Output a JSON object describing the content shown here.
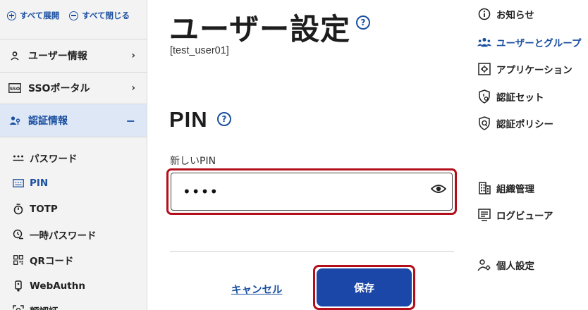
{
  "sidebar": {
    "expand_all": "すべて展開",
    "collapse_all": "すべて閉じる",
    "items": [
      {
        "label": "ユーザー情報",
        "icon": "person-icon",
        "chevron": "›"
      },
      {
        "label": "SSOポータル",
        "icon": "sso-icon",
        "chevron": "›"
      },
      {
        "label": "認証情報",
        "icon": "person-key-icon",
        "chevron": "−"
      }
    ],
    "sub_items": [
      {
        "label": "パスワード",
        "icon": "password-dots-icon"
      },
      {
        "label": "PIN",
        "icon": "pin-pad-icon"
      },
      {
        "label": "TOTP",
        "icon": "timer-icon"
      },
      {
        "label": "一時パスワード",
        "icon": "clock-key-icon"
      },
      {
        "label": "QRコード",
        "icon": "qr-code-icon"
      },
      {
        "label": "WebAuthn",
        "icon": "security-key-icon"
      },
      {
        "label": "顔認証",
        "icon": "face-scan-icon"
      }
    ]
  },
  "main": {
    "title": "ユーザー設定",
    "user_id": "[test_user01]",
    "section_title": "PIN",
    "pin_label": "新しいPIN",
    "pin_value": "••••",
    "cancel_label": "キャンセル",
    "save_label": "保存"
  },
  "right_nav": {
    "items": [
      {
        "label": "お知らせ",
        "icon": "info-icon"
      },
      {
        "label": "ユーザーとグループ",
        "icon": "users-group-icon"
      },
      {
        "label": "アプリケーション",
        "icon": "gear-box-icon"
      },
      {
        "label": "認証セット",
        "icon": "shield-gear-icon"
      },
      {
        "label": "認証ポリシー",
        "icon": "shield-q-icon"
      },
      {
        "label": "組織管理",
        "icon": "building-icon"
      },
      {
        "label": "ログビューア",
        "icon": "log-viewer-icon"
      },
      {
        "label": "個人設定",
        "icon": "person-gear-icon"
      }
    ]
  },
  "colors": {
    "accent": "#1a4fa0",
    "highlight_outline": "#b30f1a",
    "save_button": "#1a47a8"
  }
}
